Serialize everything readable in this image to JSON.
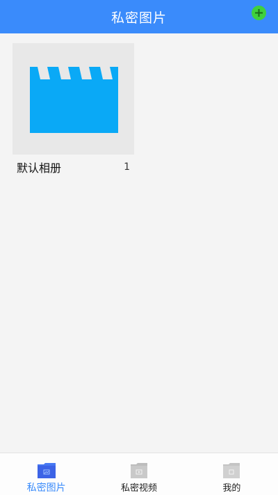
{
  "header": {
    "title": "私密图片",
    "add_icon": "plus-circle-icon",
    "add_color": "#3fd13d",
    "bg_color": "#3a8bfb"
  },
  "albums": [
    {
      "name": "默认相册",
      "count": "1",
      "thumb_icon": "clapperboard-icon",
      "thumb_color": "#0aa9f6"
    }
  ],
  "bottom_nav": {
    "items": [
      {
        "label": "私密图片",
        "icon": "image-folder-icon",
        "active": true
      },
      {
        "label": "私密视频",
        "icon": "video-folder-icon",
        "active": false
      },
      {
        "label": "我的",
        "icon": "profile-folder-icon",
        "active": false
      }
    ],
    "active_color": "#3a8bfb"
  }
}
